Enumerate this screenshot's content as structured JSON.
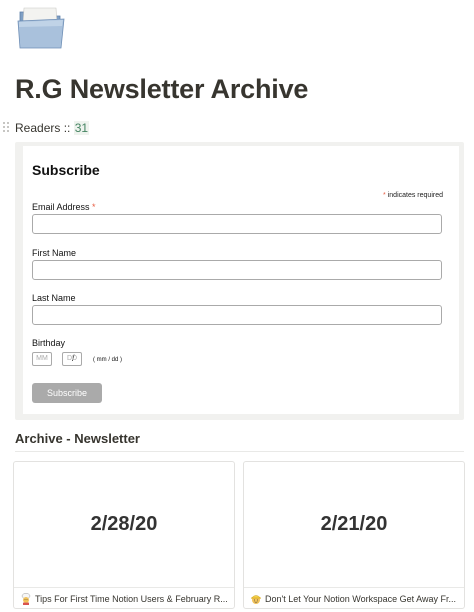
{
  "page": {
    "title": "R.G Newsletter Archive",
    "icon": "folder-icon"
  },
  "readers": {
    "label": "Readers ::",
    "count": "31"
  },
  "subscribe_form": {
    "heading": "Subscribe",
    "required_note": "indicates required",
    "email_label": "Email Address",
    "first_name_label": "First Name",
    "last_name_label": "Last Name",
    "birthday_label": "Birthday",
    "birthday_month_placeholder": "MM",
    "birthday_day_placeholder": "DD",
    "birthday_separator": "/",
    "birthday_hint": "( mm / dd )",
    "submit_label": "Subscribe",
    "accent_color": "#e85c41",
    "button_color": "#aaaaaa"
  },
  "archive": {
    "section_title": "Archive - Newsletter",
    "cards": [
      {
        "date": "2/28/20",
        "title": "Tips For First Time Notion Users & February R...",
        "emoji": "cook-emoji-icon"
      },
      {
        "date": "2/21/20",
        "title": "Don't Let Your Notion Workspace Get Away Fr...",
        "emoji": "hard-hat-face-emoji-icon"
      }
    ]
  }
}
